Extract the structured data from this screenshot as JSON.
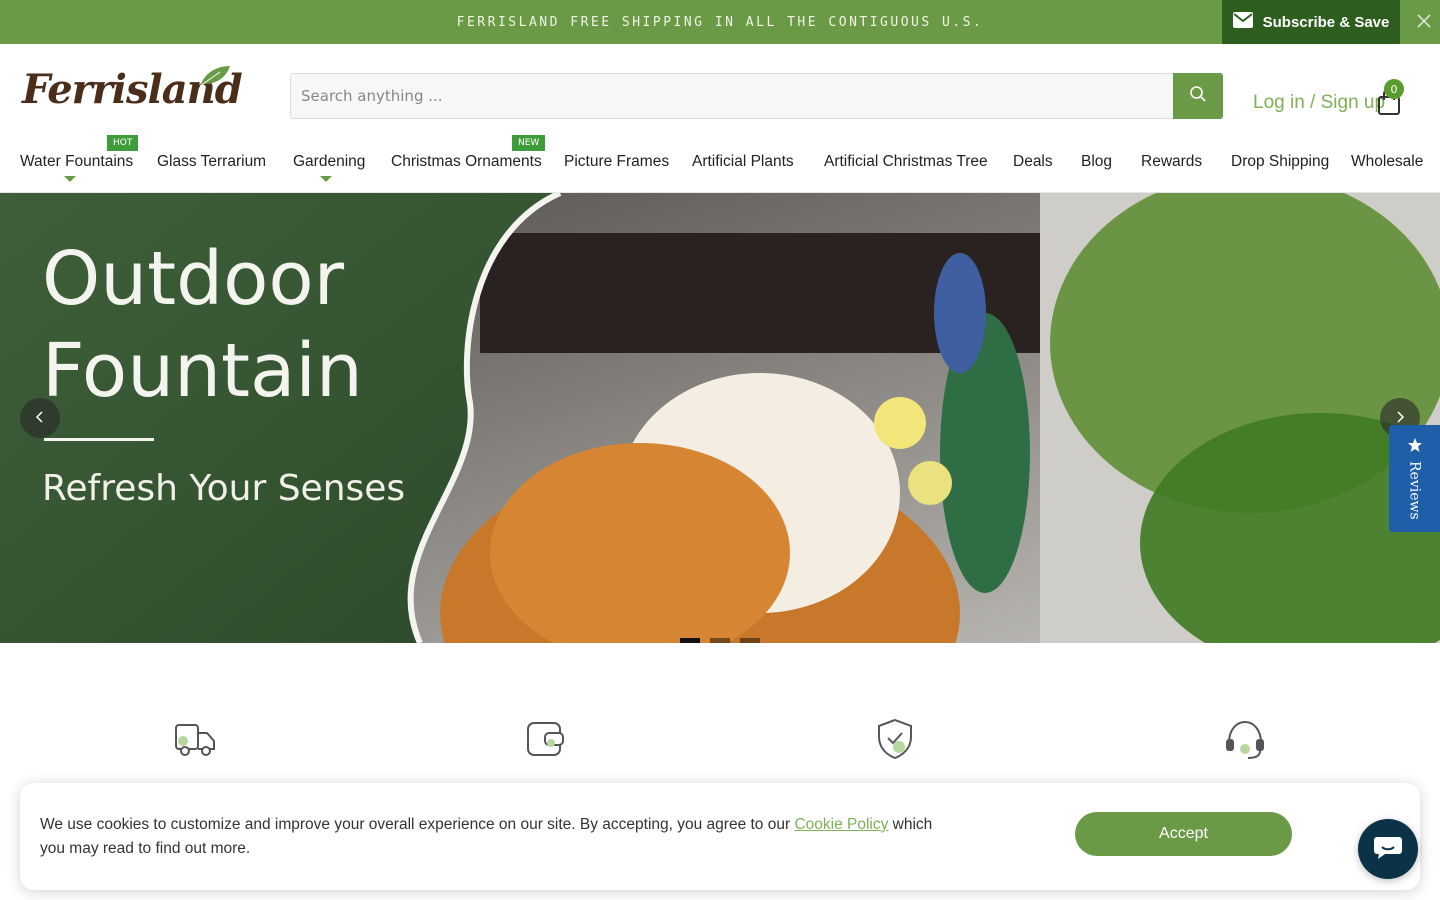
{
  "announcement": {
    "text": "FERRISLAND FREE SHIPPING IN ALL THE CONTIGUOUS U.S.",
    "subscribe_label": "Subscribe & Save"
  },
  "header": {
    "logo_text": "Ferrisland",
    "search_placeholder": "Search anything ...",
    "login_label": "Log in / Sign up",
    "cart_count": "0"
  },
  "nav": {
    "items": [
      {
        "label": "Water Fountains",
        "badge": "HOT"
      },
      {
        "label": "Glass Terrarium"
      },
      {
        "label": "Gardening"
      },
      {
        "label": "Christmas Ornaments",
        "badge": "NEW"
      },
      {
        "label": "Picture Frames"
      },
      {
        "label": "Artificial Plants"
      },
      {
        "label": "Artificial Christmas Tree"
      },
      {
        "label": "Deals"
      },
      {
        "label": "Blog"
      },
      {
        "label": "Rewards"
      },
      {
        "label": "Drop Shipping"
      },
      {
        "label": "Wholesale"
      }
    ]
  },
  "hero": {
    "title_line1": "Outdoor",
    "title_line2": "Fountain",
    "subtitle": "Refresh Your Senses",
    "slide_count": 3,
    "active_slide": 1
  },
  "reviews_tab": {
    "label": "Reviews"
  },
  "features": {
    "icons": [
      "delivery-truck-icon",
      "wallet-icon",
      "shield-check-icon",
      "headset-icon"
    ]
  },
  "cookie": {
    "text_before": "We use cookies to customize and improve your overall experience on our site. By accepting, you agree to our ",
    "link_text": "Cookie Policy",
    "text_after": " which you may read to find out more.",
    "accept_label": "Accept"
  },
  "colors": {
    "brand_green": "#6a9a45",
    "dark_green": "#2e5e1e",
    "link_green": "#7fb056",
    "reviews_blue": "#1f5ea8",
    "chat_navy": "#0b3246"
  }
}
